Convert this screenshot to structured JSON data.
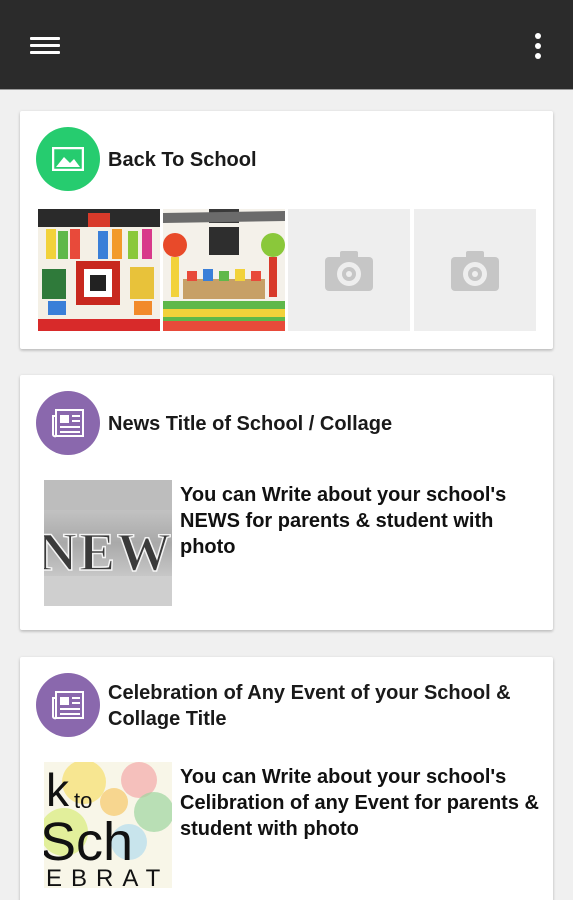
{
  "colors": {
    "appbar": "#2b2b2b",
    "gallery_avatar": "#26cc6f",
    "news_avatar": "#8a68ad",
    "background": "#f0f0f0"
  },
  "appbar": {
    "menu_icon": "hamburger-menu-icon",
    "overflow_icon": "more-vertical-icon"
  },
  "cards": [
    {
      "title": "Back To School",
      "icon": "image-icon",
      "thumbnails": [
        "back-to-school-photo-1",
        "back-to-school-photo-2",
        "camera-placeholder",
        "camera-placeholder"
      ]
    },
    {
      "title": "News Title of School / Collage",
      "icon": "newspaper-icon",
      "image_text": "NEWS",
      "description": "You  can Write about your school's NEWS for parents & student with photo"
    },
    {
      "title": "Celebration of Any Event of your School & Collage Title",
      "icon": "newspaper-icon",
      "image_text": [
        "k",
        "to",
        "Sch",
        "EBRAT"
      ],
      "description": "You  can Write about your school's Celibration of any Event for parents & student with photo"
    }
  ]
}
